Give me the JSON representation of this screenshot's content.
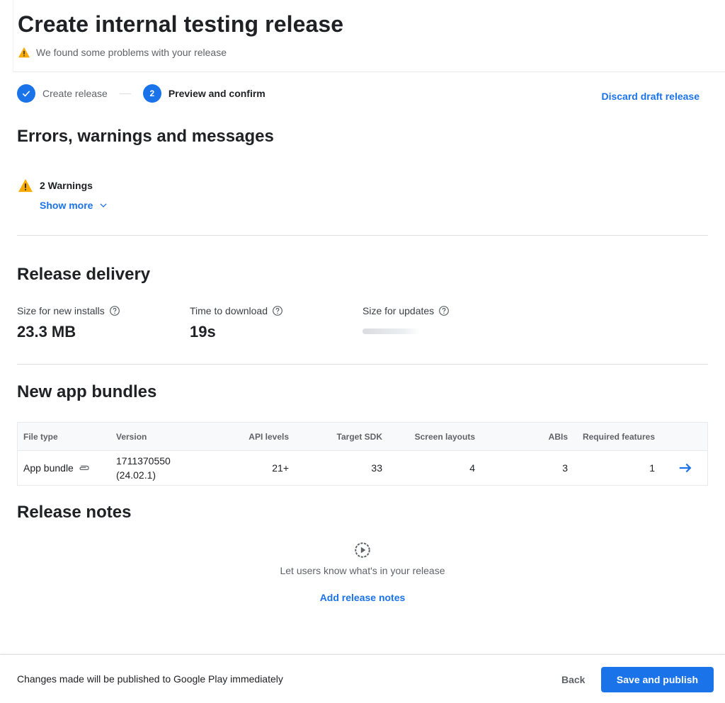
{
  "header": {
    "title": "Create internal testing release",
    "problem_message": "We found some problems with your release"
  },
  "stepper": {
    "steps": [
      {
        "label": "Create release",
        "state": "done"
      },
      {
        "label": "Preview and confirm",
        "number": "2",
        "state": "active"
      }
    ],
    "discard_label": "Discard draft release"
  },
  "errors_section": {
    "title": "Errors, warnings and messages",
    "warnings_label": "2 Warnings",
    "show_more_label": "Show more"
  },
  "delivery": {
    "title": "Release delivery",
    "metrics": [
      {
        "label": "Size for new installs",
        "value": "23.3 MB"
      },
      {
        "label": "Time to download",
        "value": "19s"
      },
      {
        "label": "Size for updates",
        "value": ""
      }
    ]
  },
  "bundles": {
    "title": "New app bundles",
    "columns": [
      "File type",
      "Version",
      "API levels",
      "Target SDK",
      "Screen layouts",
      "ABIs",
      "Required features"
    ],
    "rows": [
      {
        "file_type": "App bundle",
        "version_code": "1711370550",
        "version_name": "(24.02.1)",
        "api_levels": "21+",
        "target_sdk": "33",
        "screen_layouts": "4",
        "abis": "3",
        "required_features": "1"
      }
    ]
  },
  "release_notes": {
    "title": "Release notes",
    "empty_text": "Let users know what's in your release",
    "add_label": "Add release notes"
  },
  "footer": {
    "message": "Changes made will be published to Google Play immediately",
    "back_label": "Back",
    "publish_label": "Save and publish"
  },
  "icons": {
    "warning": "warning-icon",
    "check": "check-icon",
    "help": "help-icon",
    "chevron": "chevron-down-icon",
    "attachment": "paperclip-icon",
    "arrow": "arrow-right-icon",
    "notes": "play-circle-icon"
  },
  "colors": {
    "accent": "#1a73e8",
    "warning": "#f9ab00",
    "text": "#202124",
    "muted": "#5f6368"
  }
}
